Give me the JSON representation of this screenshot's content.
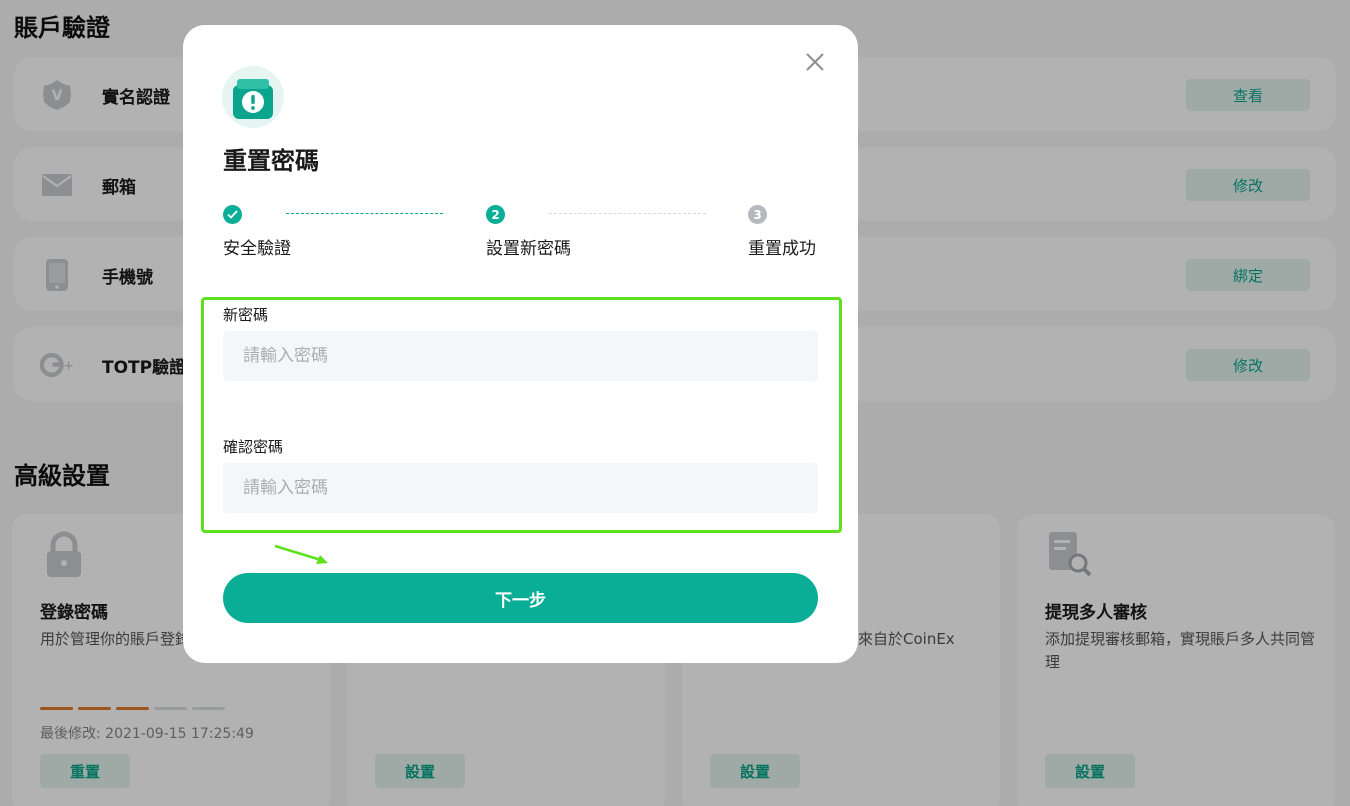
{
  "background": {
    "account_section_title": "賬戶驗證",
    "account_rows": [
      {
        "label": "實名認證",
        "button": "查看",
        "icon": "v-badge-icon"
      },
      {
        "label": "郵箱",
        "button": "修改",
        "icon": "mail-icon"
      },
      {
        "label": "手機號",
        "button": "綁定",
        "icon": "phone-icon"
      },
      {
        "label": "TOTP驗證",
        "button": "修改",
        "icon": "google-auth-icon"
      }
    ],
    "advanced_section_title": "高級設置",
    "advanced_cards": [
      {
        "title": "登錄密碼",
        "desc": "用於管理你的賬戶登錄",
        "last_modified": "最後修改: 2021-09-15 17:25:49",
        "button": "重置",
        "icon": "lock-icon"
      },
      {
        "title": "",
        "desc": "",
        "button": "設置"
      },
      {
        "title": "",
        "desc": "來自於CoinEx",
        "button": "設置"
      },
      {
        "title": "提現多人審核",
        "desc": "添加提現審核郵箱，實現賬戶多人共同管理",
        "button": "設置",
        "icon": "review-search-icon"
      }
    ],
    "password_strength": {
      "filled": 3,
      "total": 5
    }
  },
  "modal": {
    "title": "重置密碼",
    "steps": [
      {
        "number": "",
        "label": "安全驗證",
        "status": "done"
      },
      {
        "number": "2",
        "label": "設置新密碼",
        "status": "active"
      },
      {
        "number": "3",
        "label": "重置成功",
        "status": "pending"
      }
    ],
    "new_password": {
      "label": "新密碼",
      "placeholder": "請輸入密碼",
      "value": ""
    },
    "confirm_password": {
      "label": "確認密碼",
      "placeholder": "請輸入密碼",
      "value": ""
    },
    "next_button": "下一步"
  },
  "colors": {
    "accent": "#0aae96",
    "accent_light": "#e4f4ef",
    "highlight": "#5fe01e",
    "pending": "#b5b9be",
    "strength_on": "#e07a2a",
    "strength_off": "#dcdfe3"
  }
}
